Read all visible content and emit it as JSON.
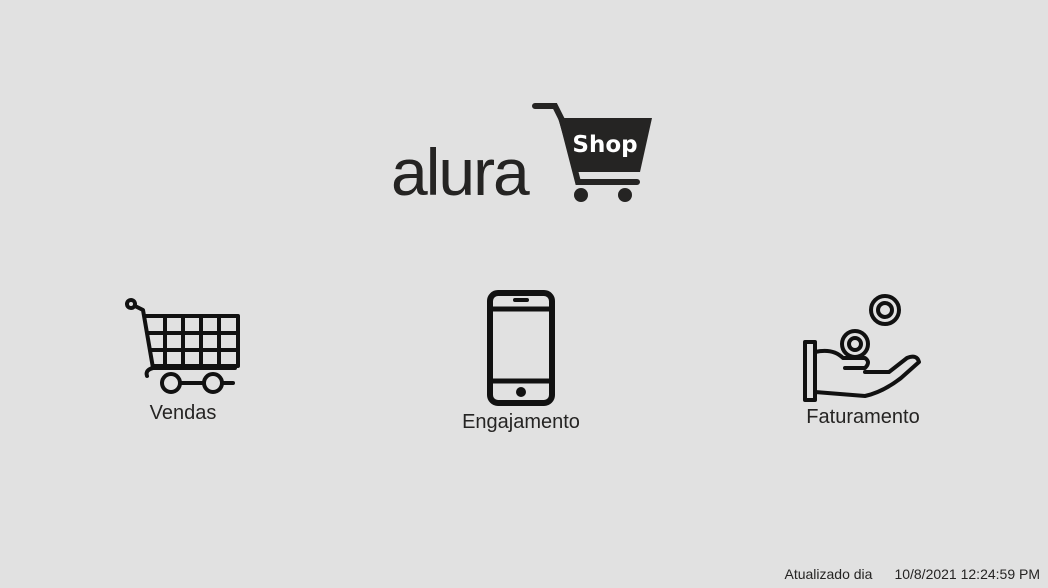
{
  "logo": {
    "brand": "alura",
    "sub": "Shop"
  },
  "nav": [
    {
      "label": "Vendas",
      "icon": "shopping-cart-icon"
    },
    {
      "label": "Engajamento",
      "icon": "smartphone-icon"
    },
    {
      "label": "Faturamento",
      "icon": "hand-coins-icon"
    }
  ],
  "footer": {
    "label": "Atualizado dia",
    "timestamp": "10/8/2021 12:24:59 PM"
  },
  "colors": {
    "background": "#e1e1e1",
    "ink": "#252423"
  }
}
